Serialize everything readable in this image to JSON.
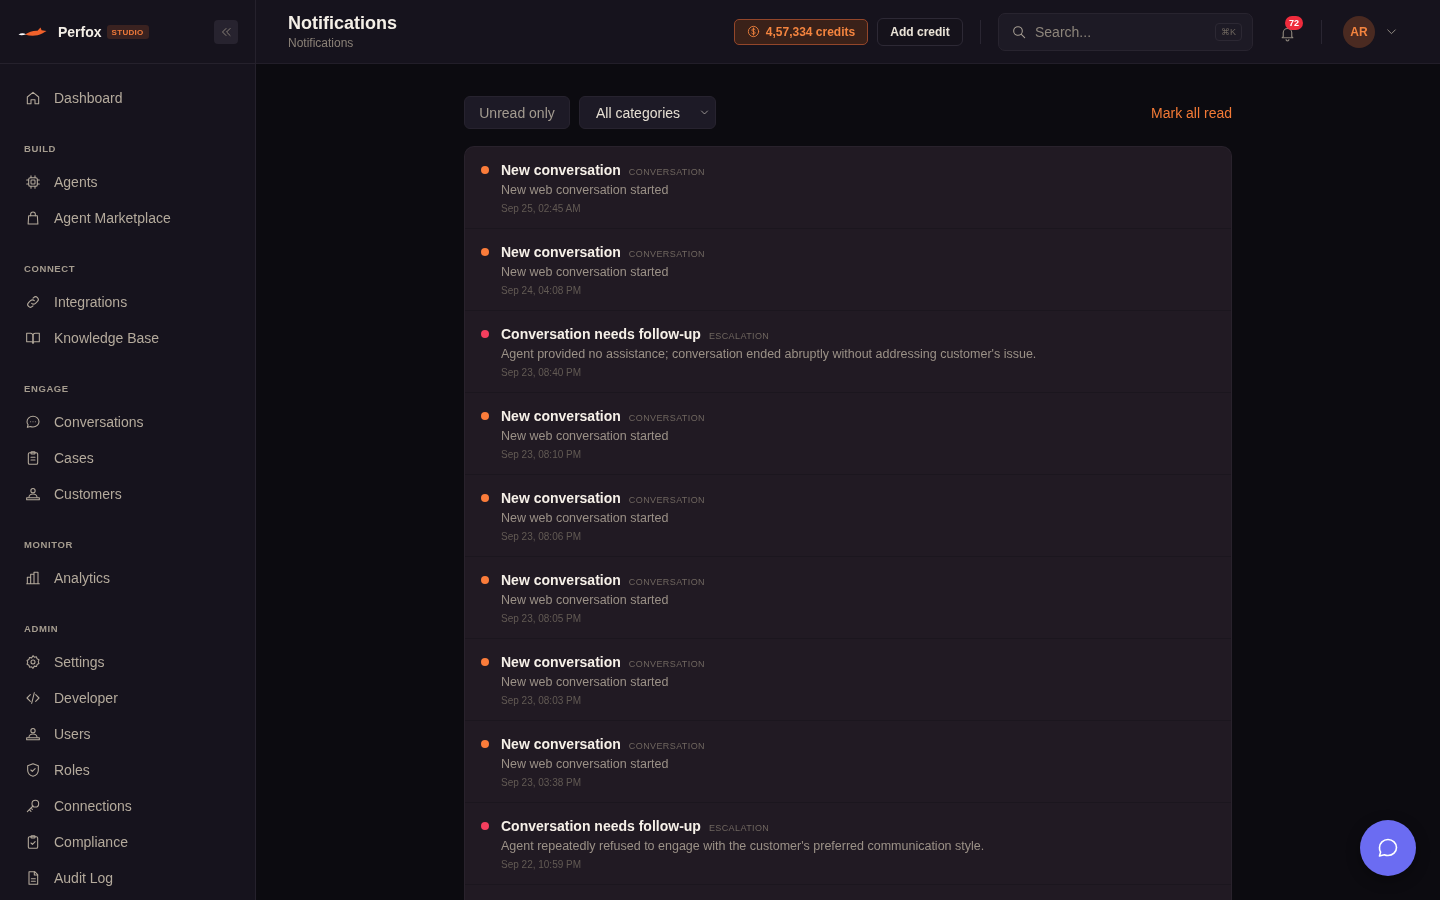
{
  "sidebar": {
    "brand": {
      "name": "Perfox",
      "badge": "STUDIO"
    },
    "items": [
      {
        "label": "Dashboard",
        "selected": false
      }
    ],
    "sections": [
      {
        "title": "BUILD",
        "items": [
          {
            "label": "Agents",
            "selected": false
          },
          {
            "label": "Agent Marketplace",
            "selected": false
          }
        ]
      },
      {
        "title": "CONNECT",
        "items": [
          {
            "label": "Integrations",
            "selected": false
          },
          {
            "label": "Knowledge Base",
            "selected": false
          }
        ]
      },
      {
        "title": "ENGAGE",
        "items": [
          {
            "label": "Conversations",
            "selected": false
          },
          {
            "label": "Cases",
            "selected": false
          },
          {
            "label": "Customers",
            "selected": false
          }
        ]
      },
      {
        "title": "MONITOR",
        "items": [
          {
            "label": "Analytics",
            "selected": false
          }
        ]
      },
      {
        "title": "ADMIN",
        "items": [
          {
            "label": "Settings",
            "selected": false
          },
          {
            "label": "Developer",
            "selected": false
          },
          {
            "label": "Users",
            "selected": false
          },
          {
            "label": "Roles",
            "selected": false
          },
          {
            "label": "Connections",
            "selected": false
          },
          {
            "label": "Compliance",
            "selected": false
          },
          {
            "label": "Audit Log",
            "selected": false
          }
        ]
      }
    ]
  },
  "header": {
    "title": "Notifications",
    "subtitle": "Notifications",
    "credits": "4,57,334 credits",
    "add_credit": "Add credit",
    "search": {
      "placeholder": "Search...",
      "shortcut": "⌘K"
    },
    "notification_count": "72",
    "avatar": "AR"
  },
  "filters": {
    "unread_only": {
      "label": "Unread only",
      "on": false
    },
    "category": {
      "value": "All categories"
    },
    "mark_all_read": "Mark all read"
  },
  "notifications": [
    {
      "title": "New conversation",
      "category": "CONVERSATION",
      "description": "New web conversation started",
      "time": "Sep 25, 02:45 AM",
      "color": "#fb7c3a"
    },
    {
      "title": "New conversation",
      "category": "CONVERSATION",
      "description": "New web conversation started",
      "time": "Sep 24, 04:08 PM",
      "color": "#fb7c3a"
    },
    {
      "title": "Conversation needs follow-up",
      "category": "ESCALATION",
      "description": "Agent provided no assistance; conversation ended abruptly without addressing customer's issue.",
      "time": "Sep 23, 08:40 PM",
      "color": "#f43f5e"
    },
    {
      "title": "New conversation",
      "category": "CONVERSATION",
      "description": "New web conversation started",
      "time": "Sep 23, 08:10 PM",
      "color": "#fb7c3a"
    },
    {
      "title": "New conversation",
      "category": "CONVERSATION",
      "description": "New web conversation started",
      "time": "Sep 23, 08:06 PM",
      "color": "#fb7c3a"
    },
    {
      "title": "New conversation",
      "category": "CONVERSATION",
      "description": "New web conversation started",
      "time": "Sep 23, 08:05 PM",
      "color": "#fb7c3a"
    },
    {
      "title": "New conversation",
      "category": "CONVERSATION",
      "description": "New web conversation started",
      "time": "Sep 23, 08:03 PM",
      "color": "#fb7c3a"
    },
    {
      "title": "New conversation",
      "category": "CONVERSATION",
      "description": "New web conversation started",
      "time": "Sep 23, 03:38 PM",
      "color": "#fb7c3a"
    },
    {
      "title": "Conversation needs follow-up",
      "category": "ESCALATION",
      "description": "Agent repeatedly refused to engage with the customer's preferred communication style.",
      "time": "Sep 22, 10:59 PM",
      "color": "#f43f5e"
    }
  ]
}
